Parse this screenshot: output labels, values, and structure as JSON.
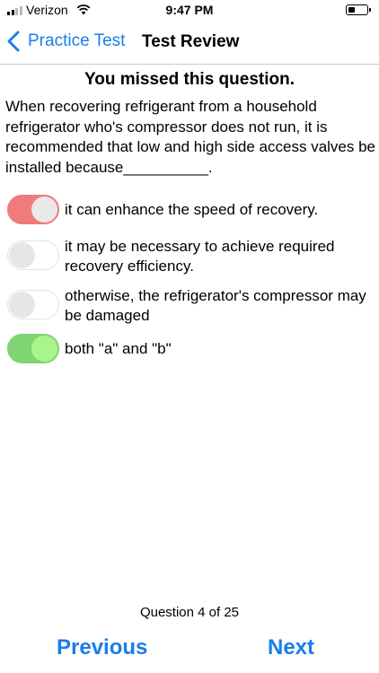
{
  "status_bar": {
    "carrier": "Verizon",
    "time": "9:47 PM",
    "icons": [
      "signal-icon",
      "wifi-icon",
      "battery-icon"
    ]
  },
  "nav": {
    "back_label": "Practice Test",
    "title": "Test Review"
  },
  "review": {
    "heading": "You missed this question.",
    "question": "When recovering refrigerant from a household refrigerator who's compressor does not run, it is recommended that low and high side access valves be installed because__________.",
    "answers": [
      {
        "label": "it can enhance the speed of recovery.",
        "state": "selected-incorrect",
        "color": "#f07a7c"
      },
      {
        "label": "it may be necessary to achieve required recovery efficiency.",
        "state": "off"
      },
      {
        "label": "otherwise, the refrigerator's compressor may be damaged",
        "state": "off"
      },
      {
        "label": "both \"a\" and \"b\"",
        "state": "correct",
        "color": "#7fd474"
      }
    ],
    "counter": "Question 4 of 25"
  },
  "footer": {
    "previous_label": "Previous",
    "next_label": "Next",
    "accent_color": "#1a7ee8"
  }
}
